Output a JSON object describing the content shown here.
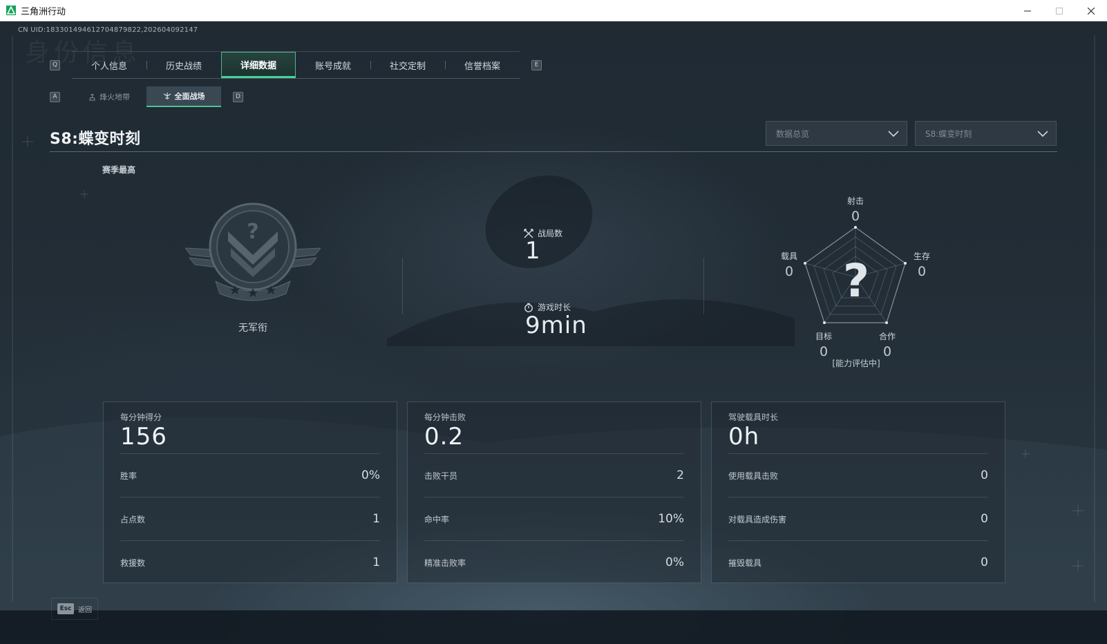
{
  "window": {
    "title": "三角洲行动",
    "minimize": "—",
    "maximize": "☐",
    "close": "✕"
  },
  "uid": "CN UID:183301494612704879822,202604092147",
  "ghost_title": "身份信息",
  "tabs": {
    "prev_key": "Q",
    "next_key": "E",
    "items": [
      {
        "label": "个人信息"
      },
      {
        "label": "历史战绩"
      },
      {
        "label": "详细数据"
      },
      {
        "label": "账号成就"
      },
      {
        "label": "社交定制"
      },
      {
        "label": "信誉档案"
      }
    ],
    "active": "详细数据"
  },
  "subtabs": {
    "prev_key": "A",
    "next_key": "D",
    "items": [
      {
        "label": "烽火地带"
      },
      {
        "label": "全面战场"
      }
    ],
    "active": "全面战场"
  },
  "season": {
    "title": "S8:蝶变时刻",
    "dropdown_view": "数据总览",
    "dropdown_season": "S8:蝶变时刻"
  },
  "best": {
    "label": "赛季最高",
    "rank_name": "无军衔"
  },
  "summary": {
    "matches_label": "战局数",
    "matches_value": "1",
    "time_label": "游戏时长",
    "time_value": "9min"
  },
  "radar": {
    "center_mark": "?",
    "note": "[能力评估中]",
    "axes": [
      {
        "label": "射击",
        "value": "0"
      },
      {
        "label": "生存",
        "value": "0"
      },
      {
        "label": "合作",
        "value": "0"
      },
      {
        "label": "目标",
        "value": "0"
      },
      {
        "label": "载具",
        "value": "0"
      }
    ]
  },
  "cards": [
    {
      "head_label": "每分钟得分",
      "head_value": "156",
      "rows": [
        {
          "label": "胜率",
          "value": "0%"
        },
        {
          "label": "占点数",
          "value": "1"
        },
        {
          "label": "救援数",
          "value": "1"
        }
      ]
    },
    {
      "head_label": "每分钟击败",
      "head_value": "0.2",
      "rows": [
        {
          "label": "击败干员",
          "value": "2"
        },
        {
          "label": "命中率",
          "value": "10%"
        },
        {
          "label": "精准击败率",
          "value": "0%"
        }
      ]
    },
    {
      "head_label": "驾驶载具时长",
      "head_value": "0h",
      "rows": [
        {
          "label": "使用载具击败",
          "value": "0"
        },
        {
          "label": "对载具造成伤害",
          "value": "0"
        },
        {
          "label": "摧毁载具",
          "value": "0"
        }
      ]
    }
  ],
  "footer": {
    "esc_key": "Esc",
    "back_label": "返回"
  },
  "colors": {
    "accent": "#49d09a",
    "background": "#222d36",
    "app_icon": "#14a35a"
  },
  "icons": {
    "app": "delta-force-logo-icon",
    "matches": "crossed-swords-icon",
    "time": "stopwatch-icon",
    "subtab_1": "beacon-icon",
    "subtab_2": "battlefield-icon",
    "dropdown": "chevron-down-icon"
  }
}
